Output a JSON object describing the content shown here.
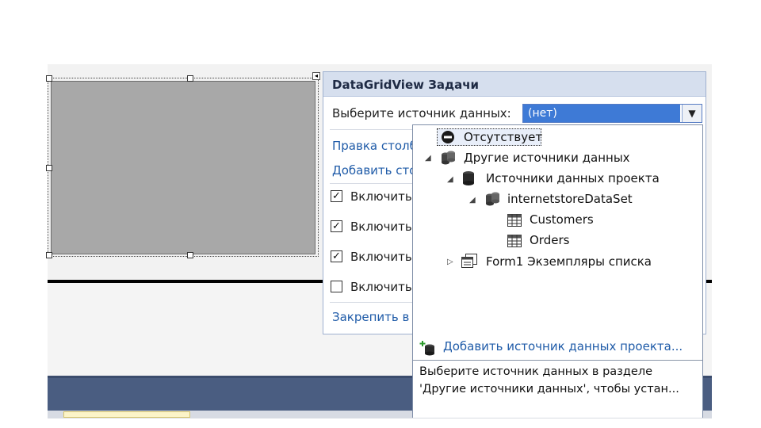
{
  "tasks": {
    "title": "DataGridView Задачи",
    "datasource_label": "Выберите источник данных:",
    "datasource_value": "(нет)",
    "edit_columns": "Правка столбцов...",
    "add_column": "Добавить столбец...",
    "checkboxes": [
      {
        "label": "Включить добавление",
        "checked": true
      },
      {
        "label": "Включить правку",
        "checked": true
      },
      {
        "label": "Включить удаление",
        "checked": true
      },
      {
        "label": "Включить переупорядочение столбцов",
        "checked": false
      }
    ],
    "dock": "Закрепить в родительском контейнере"
  },
  "dropdown": {
    "none_item": "Отсутствует",
    "other_sources": "Другие источники данных",
    "project_sources": "Источники данных проекта",
    "dataset": "internetstoreDataSet",
    "tables": [
      "Customers",
      "Orders"
    ],
    "form_instances": "Form1 Экземпляры списка",
    "add_project_source": "Добавить источник данных проекта...",
    "description_line1": "Выберите источник данных в разделе",
    "description_line2": "'Другие источники данных', чтобы устан..."
  },
  "colors": {
    "accent": "#3e7ad6",
    "panel_header": "#d6dfee",
    "link": "#1f5ba8",
    "statusbar": "#4a5d81"
  }
}
